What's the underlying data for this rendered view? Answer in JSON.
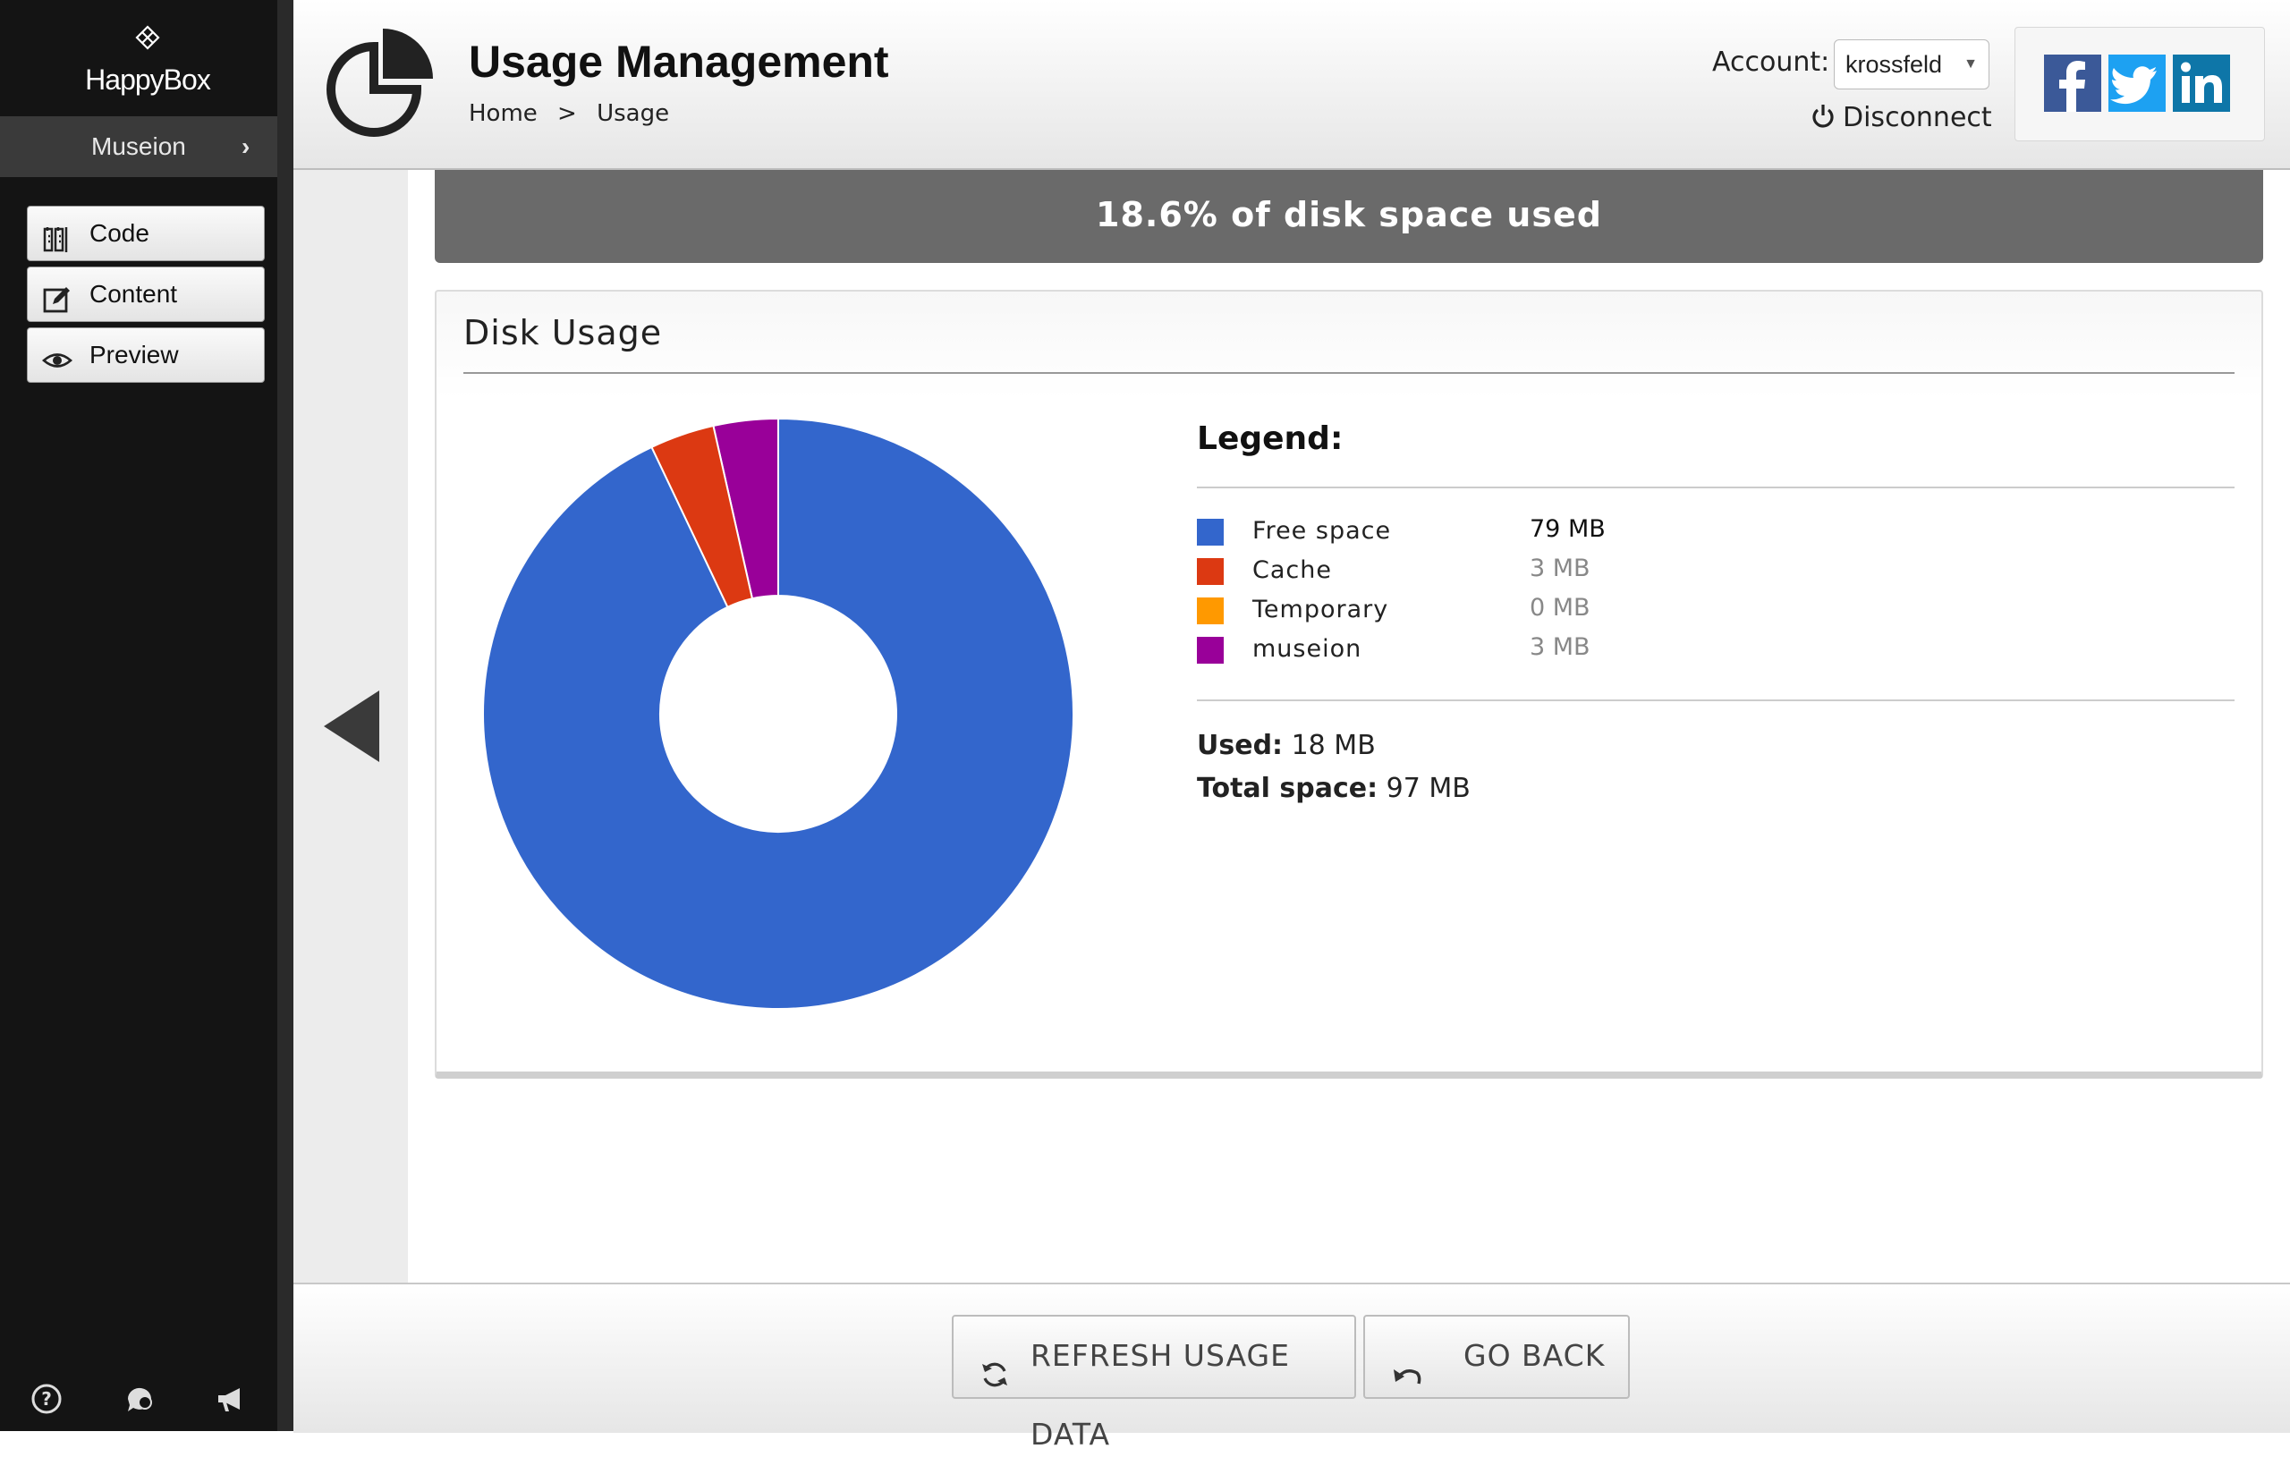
{
  "sidebar": {
    "brand": "HappyBox",
    "project": "Museion",
    "nav": [
      {
        "label": "Code",
        "icon": "code-icon"
      },
      {
        "label": "Content",
        "icon": "edit-icon"
      },
      {
        "label": "Preview",
        "icon": "eye-icon"
      }
    ],
    "bottom_icons": [
      "help-icon",
      "support-chat-icon",
      "announcement-icon"
    ]
  },
  "header": {
    "title": "Usage Management",
    "breadcrumb": [
      "Home",
      ">",
      "Usage"
    ],
    "account_label": "Account:",
    "account_value": "krossfeld",
    "disconnect_label": "Disconnect",
    "social": [
      "facebook-icon",
      "twitter-icon",
      "linkedin-icon"
    ]
  },
  "status": {
    "text": "18.6% of disk space used",
    "used_percent": 18.6
  },
  "disk_card": {
    "title": "Disk Usage",
    "legend_title": "Legend:",
    "legend": [
      {
        "name": "Free space",
        "value": "79 MB",
        "color": "#3366cc"
      },
      {
        "name": "Cache",
        "value": "3 MB",
        "color": "#dc3912"
      },
      {
        "name": "Temporary",
        "value": "0 MB",
        "color": "#ff9900"
      },
      {
        "name": "museion",
        "value": "3 MB",
        "color": "#990099"
      }
    ],
    "used_label": "Used:",
    "used_value": "18 MB",
    "total_label": "Total space:",
    "total_value": "97 MB"
  },
  "chart_data": {
    "type": "pie",
    "categories": [
      "Free space",
      "Cache",
      "Temporary",
      "museion"
    ],
    "values": [
      79,
      3,
      0,
      3
    ],
    "colors": [
      "#3366cc",
      "#dc3912",
      "#ff9900",
      "#990099"
    ],
    "donut_hole": true
  },
  "footer": {
    "refresh_label": "REFRESH USAGE DATA",
    "back_label": "GO BACK"
  }
}
